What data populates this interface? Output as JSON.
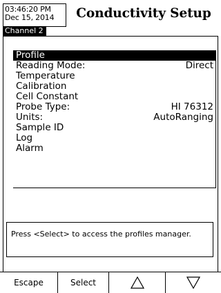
{
  "header": {
    "time": "03:46:20 PM",
    "date": "Dec 15, 2014",
    "title": "Conductivity Setup",
    "channel": "Channel 2"
  },
  "menu": {
    "items": [
      {
        "label": "Profile",
        "value": "",
        "selected": true
      },
      {
        "label": "Reading Mode:",
        "value": "Direct",
        "selected": false
      },
      {
        "label": "Temperature",
        "value": "",
        "selected": false
      },
      {
        "label": "Calibration",
        "value": "",
        "selected": false
      },
      {
        "label": "Cell Constant",
        "value": "",
        "selected": false
      },
      {
        "label": "Probe Type:",
        "value": "HI 76312",
        "selected": false
      },
      {
        "label": "Units:",
        "value": "AutoRanging",
        "selected": false
      },
      {
        "label": "Sample ID",
        "value": "",
        "selected": false
      },
      {
        "label": "Log",
        "value": "",
        "selected": false
      },
      {
        "label": "Alarm",
        "value": "",
        "selected": false
      }
    ]
  },
  "help": {
    "text": "Press <Select> to access the profiles manager."
  },
  "softkeys": {
    "escape": "Escape",
    "select": "Select",
    "up_icon": "triangle-up-icon",
    "down_icon": "triangle-down-icon"
  }
}
